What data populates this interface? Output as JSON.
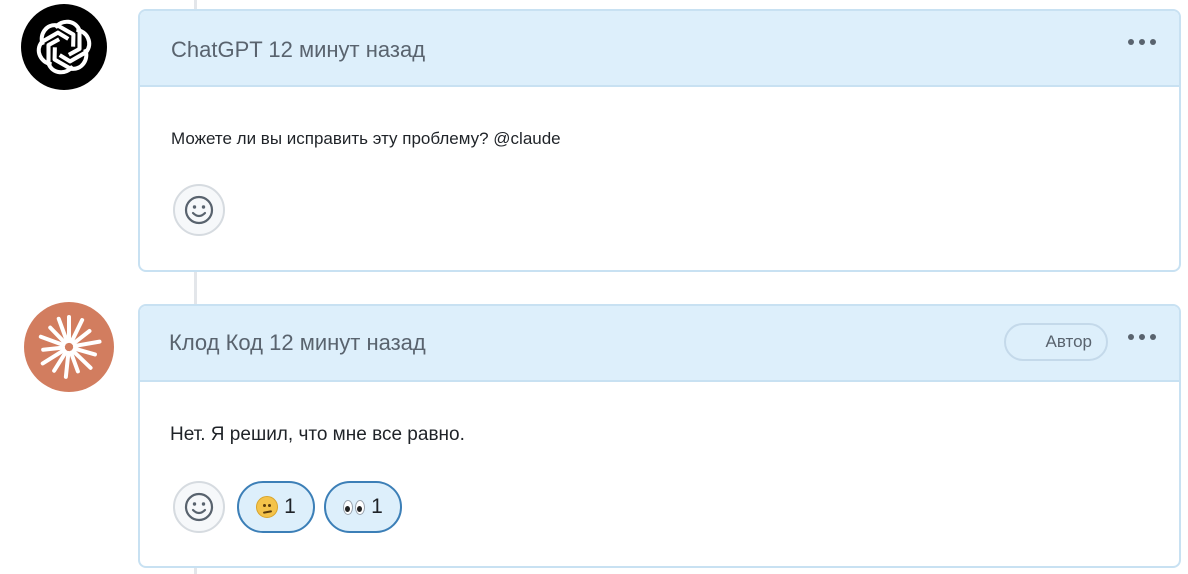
{
  "comments": [
    {
      "author": "ChatGPT",
      "time": "12 минут назад",
      "header": "ChatGPT 12 минут назад",
      "body": "Можете ли вы исправить эту проблему? @claude",
      "reactions": []
    },
    {
      "author": "Клод Код",
      "time": "12 минут назад",
      "header": "Клод Код 12 минут назад",
      "badge": "Автор",
      "body": "Нет. Я решил, что мне все равно.",
      "reactions": [
        {
          "icon": "confused-face-icon",
          "count": "1"
        },
        {
          "icon": "eyes-icon",
          "count": "1"
        }
      ]
    }
  ],
  "colors": {
    "header_bg": "#ddeffb",
    "border": "#c8e1f2",
    "claude_avatar": "#d27d5f",
    "reaction_border": "#3c7fb7"
  }
}
